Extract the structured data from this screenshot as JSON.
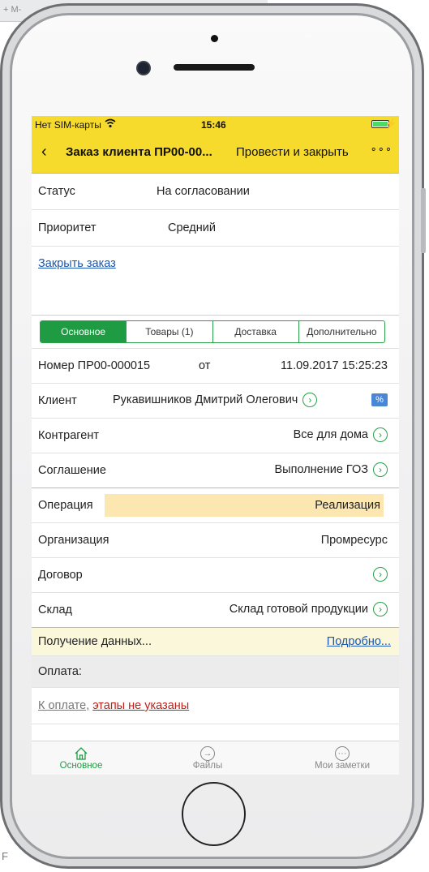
{
  "statusbar": {
    "carrier": "Нет SIM-карты",
    "time": "15:46"
  },
  "navbar": {
    "back": "‹",
    "title": "Заказ клиента ПР00-00...",
    "action": "Провести и закрыть",
    "more": "∘∘∘"
  },
  "header": {
    "status_label": "Статус",
    "status_value": "На согласовании",
    "priority_label": "Приоритет",
    "priority_value": "Средний",
    "close_order": "Закрыть заказ"
  },
  "tabs": [
    "Основное",
    "Товары (1)",
    "Доставка",
    "Дополнительно"
  ],
  "fields": {
    "number_label": "Номер",
    "number_value": "ПР00-000015",
    "from": "от",
    "date": "11.09.2017 15:25:23",
    "client_label": "Клиент",
    "client_value": "Рукавишников Дмитрий Олегович",
    "client_badge": "%",
    "contractor_label": "Контрагент",
    "contractor_value": "Все для дома",
    "agreement_label": "Соглашение",
    "agreement_value": "Выполнение ГОЗ",
    "operation_label": "Операция",
    "operation_value": "Реализация",
    "organization_label": "Организация",
    "organization_value": "Промресурс",
    "contract_label": "Договор",
    "warehouse_label": "Склад",
    "warehouse_value": "Склад готовой продукции"
  },
  "loading": {
    "text": "Получение данных...",
    "details": "Подробно..."
  },
  "payment": {
    "header": "Оплата:",
    "prefix": "К оплате,",
    "stages": "этапы не указаны"
  },
  "tabbar": [
    {
      "label": "Основное",
      "icon": "home-icon"
    },
    {
      "label": "Файлы",
      "icon": "arrow-right-icon"
    },
    {
      "label": "Мои заметки",
      "icon": "ellipsis-icon"
    }
  ],
  "background": {
    "strip_text": "+ M-",
    "corner_letter": "F"
  },
  "colors": {
    "accent_yellow": "#f6db2c",
    "accent_green": "#1f9c43",
    "link_blue": "#1a56b5",
    "operation_highlight": "#fde7b0"
  }
}
